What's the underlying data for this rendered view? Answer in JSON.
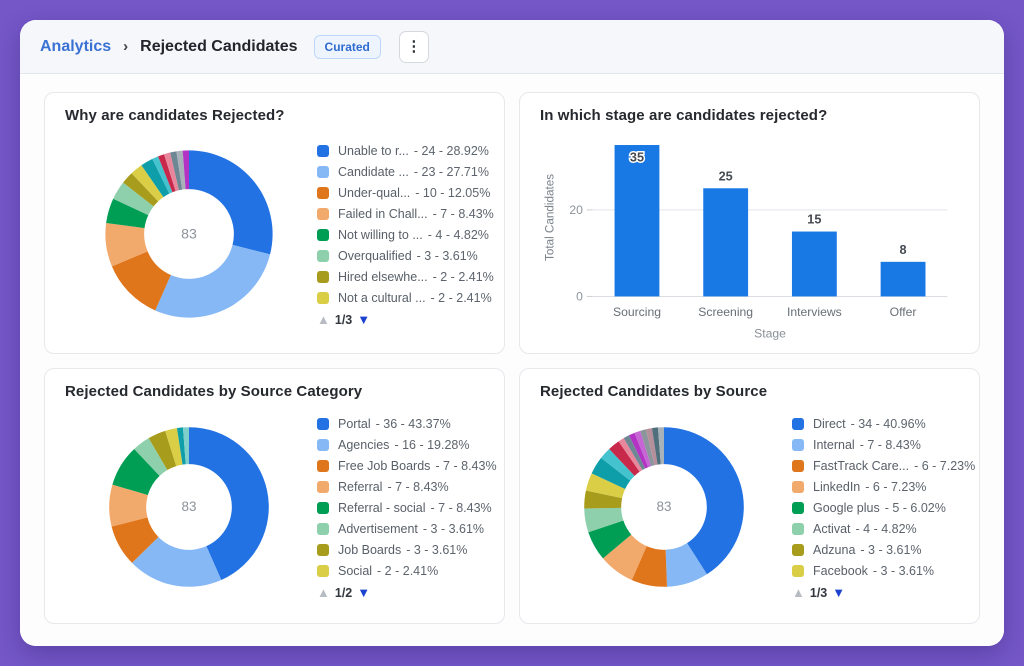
{
  "header": {
    "breadcrumb_root": "Analytics",
    "breadcrumb_separator": "›",
    "title": "Rejected Candidates",
    "badge_label": "Curated",
    "menu_icon": "kebab-vertical",
    "menu_glyph": "⋮"
  },
  "ui_colors": {
    "frame_purple": "#7557c8",
    "link_blue": "#3a72d4",
    "badge_blue": "#2e6bd0",
    "page_up_arrow_gray": "#b6bcc2",
    "page_down_arrow_blue": "#1c43cf"
  },
  "pager_icons": {
    "up": "▲",
    "down": "▼"
  },
  "chart_data": [
    {
      "id": "reject-reasons",
      "type": "donut",
      "title": "Why are candidates Rejected?",
      "center_total": "83",
      "legend_page": "1/3",
      "slices": [
        {
          "label": "Unable to r...",
          "value": 24,
          "pct": "28.92%",
          "color": "#2272e3",
          "in_legend": true
        },
        {
          "label": "Candidate ...",
          "value": 23,
          "pct": "27.71%",
          "color": "#85b8f5",
          "in_legend": true
        },
        {
          "label": "Under-qual...",
          "value": 10,
          "pct": "12.05%",
          "color": "#e0761c",
          "in_legend": true
        },
        {
          "label": "Failed in Chall...",
          "value": 7,
          "pct": "8.43%",
          "color": "#f2a96c",
          "in_legend": true
        },
        {
          "label": "Not willing to ...",
          "value": 4,
          "pct": "4.82%",
          "color": "#009e54",
          "in_legend": true
        },
        {
          "label": "Overqualified",
          "value": 3,
          "pct": "3.61%",
          "color": "#8ed0ac",
          "in_legend": true
        },
        {
          "label": "Hired elsewhe...",
          "value": 2,
          "pct": "2.41%",
          "color": "#a89c1c",
          "in_legend": true
        },
        {
          "label": "Not a cultural ...",
          "value": 2,
          "pct": "2.41%",
          "color": "#d9ce46",
          "in_legend": true
        },
        {
          "label": "",
          "value": 2,
          "pct": "",
          "color": "#0e9eaa",
          "in_legend": false
        },
        {
          "label": "",
          "value": 1,
          "pct": "",
          "color": "#44c3cf",
          "in_legend": false
        },
        {
          "label": "",
          "value": 1,
          "pct": "",
          "color": "#c8294a",
          "in_legend": false
        },
        {
          "label": "",
          "value": 1,
          "pct": "",
          "color": "#e8879c",
          "in_legend": false
        },
        {
          "label": "",
          "value": 1,
          "pct": "",
          "color": "#6e8795",
          "in_legend": false
        },
        {
          "label": "",
          "value": 1,
          "pct": "",
          "color": "#a9b2b8",
          "in_legend": false
        },
        {
          "label": "",
          "value": 1,
          "pct": "",
          "color": "#b233c4",
          "in_legend": false
        }
      ]
    },
    {
      "id": "reject-stage",
      "type": "bar",
      "title": "In which stage are candidates rejected?",
      "categories": [
        "Sourcing",
        "Screening",
        "Interviews",
        "Offer"
      ],
      "values": [
        35,
        25,
        15,
        8
      ],
      "xlabel": "Stage",
      "ylabel": "Total Candidates",
      "yticks": [
        0,
        20
      ],
      "ylim": [
        0,
        36.5
      ],
      "bar_color": "#1878e4",
      "grid": true,
      "first_label_inside": true
    },
    {
      "id": "source-category",
      "type": "donut",
      "title": "Rejected Candidates by Source Category",
      "center_total": "83",
      "legend_page": "1/2",
      "slices": [
        {
          "label": "Portal",
          "value": 36,
          "pct": "43.37%",
          "color": "#2272e3",
          "in_legend": true
        },
        {
          "label": "Agencies",
          "value": 16,
          "pct": "19.28%",
          "color": "#85b8f5",
          "in_legend": true
        },
        {
          "label": "Free Job Boards",
          "value": 7,
          "pct": "8.43%",
          "color": "#e0761c",
          "in_legend": true
        },
        {
          "label": "Referral",
          "value": 7,
          "pct": "8.43%",
          "color": "#f2a96c",
          "in_legend": true
        },
        {
          "label": "Referral - social",
          "value": 7,
          "pct": "8.43%",
          "color": "#009e54",
          "in_legend": true
        },
        {
          "label": "Advertisement",
          "value": 3,
          "pct": "3.61%",
          "color": "#8ed0ac",
          "in_legend": true
        },
        {
          "label": "Job Boards",
          "value": 3,
          "pct": "3.61%",
          "color": "#a89c1c",
          "in_legend": true
        },
        {
          "label": "Social",
          "value": 2,
          "pct": "2.41%",
          "color": "#d9ce46",
          "in_legend": true
        },
        {
          "label": "",
          "value": 1,
          "pct": "",
          "color": "#0e9eaa",
          "in_legend": false
        },
        {
          "label": "",
          "value": 1,
          "pct": "",
          "color": "#7fd0cb",
          "in_legend": false
        }
      ]
    },
    {
      "id": "source",
      "type": "donut",
      "title": "Rejected Candidates by Source",
      "center_total": "83",
      "legend_page": "1/3",
      "slices": [
        {
          "label": "Direct",
          "value": 34,
          "pct": "40.96%",
          "color": "#2272e3",
          "in_legend": true
        },
        {
          "label": "Internal",
          "value": 7,
          "pct": "8.43%",
          "color": "#85b8f5",
          "in_legend": true
        },
        {
          "label": "FastTrack Care...",
          "value": 6,
          "pct": "7.23%",
          "color": "#e0761c",
          "in_legend": true
        },
        {
          "label": "LinkedIn",
          "value": 6,
          "pct": "7.23%",
          "color": "#f2a96c",
          "in_legend": true
        },
        {
          "label": "Google plus",
          "value": 5,
          "pct": "6.02%",
          "color": "#009e54",
          "in_legend": true
        },
        {
          "label": "Activat",
          "value": 4,
          "pct": "4.82%",
          "color": "#8ed0ac",
          "in_legend": true
        },
        {
          "label": "Adzuna",
          "value": 3,
          "pct": "3.61%",
          "color": "#a89c1c",
          "in_legend": true
        },
        {
          "label": "Facebook",
          "value": 3,
          "pct": "3.61%",
          "color": "#d9ce46",
          "in_legend": true
        },
        {
          "label": "",
          "value": 3,
          "pct": "",
          "color": "#0e9eaa",
          "in_legend": false
        },
        {
          "label": "",
          "value": 2,
          "pct": "",
          "color": "#44c3cf",
          "in_legend": false
        },
        {
          "label": "",
          "value": 2,
          "pct": "",
          "color": "#c8294a",
          "in_legend": false
        },
        {
          "label": "",
          "value": 1,
          "pct": "",
          "color": "#e8879c",
          "in_legend": false
        },
        {
          "label": "",
          "value": 1,
          "pct": "",
          "color": "#6e8795",
          "in_legend": false
        },
        {
          "label": "",
          "value": 1,
          "pct": "",
          "color": "#b233c4",
          "in_legend": false
        },
        {
          "label": "",
          "value": 1,
          "pct": "",
          "color": "#c566d4",
          "in_legend": false
        },
        {
          "label": "",
          "value": 1,
          "pct": "",
          "color": "#8b959c",
          "in_legend": false
        },
        {
          "label": "",
          "value": 1,
          "pct": "",
          "color": "#b5909b",
          "in_legend": false
        },
        {
          "label": "",
          "value": 1,
          "pct": "",
          "color": "#4e6f7b",
          "in_legend": false
        },
        {
          "label": "",
          "value": 1,
          "pct": "",
          "color": "#a9b2b8",
          "in_legend": false
        }
      ]
    }
  ]
}
